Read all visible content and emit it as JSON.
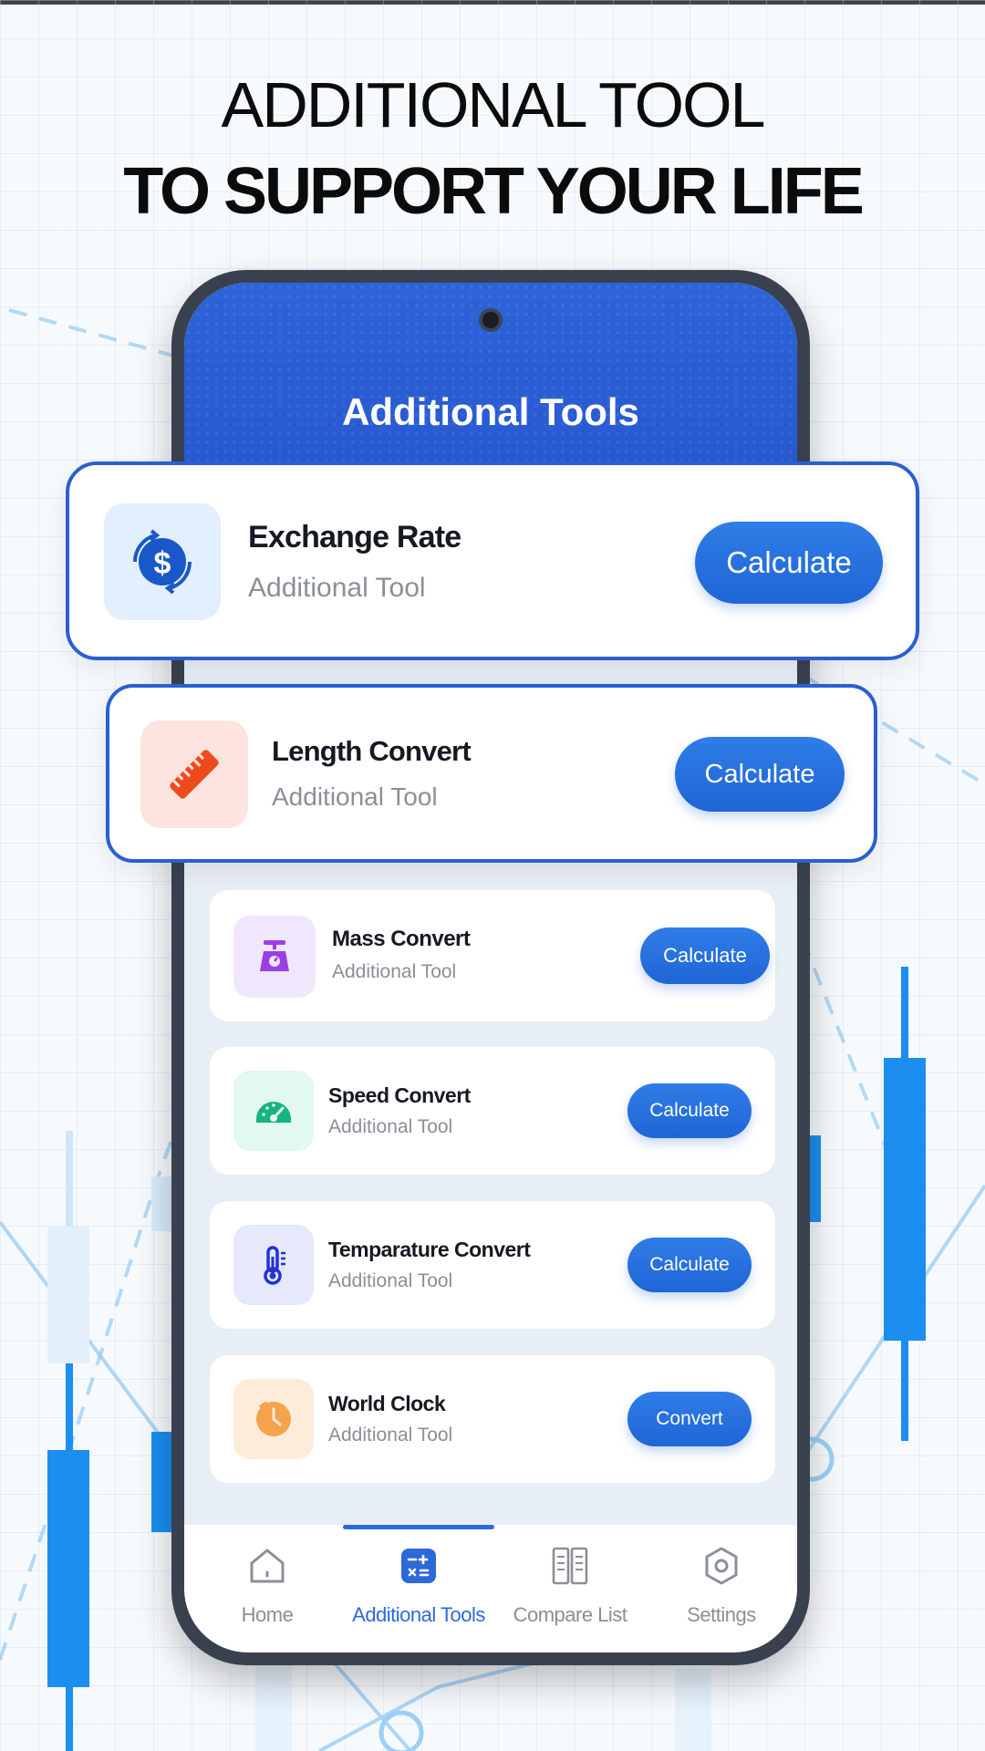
{
  "headline": {
    "line1": "ADDITIONAL TOOL",
    "line2": "TO SUPPORT YOUR LIFE"
  },
  "app": {
    "title": "Additional Tools"
  },
  "featured": [
    {
      "title": "Exchange Rate",
      "subtitle": "Additional Tool",
      "button": "Calculate",
      "icon": "exchange-rate-icon"
    },
    {
      "title": "Length Convert",
      "subtitle": "Additional Tool",
      "button": "Calculate",
      "icon": "ruler-icon"
    }
  ],
  "tools": [
    {
      "title": "Mass Convert",
      "subtitle": "Additional Tool",
      "button": "Calculate",
      "icon": "scale-icon"
    },
    {
      "title": "Speed Convert",
      "subtitle": "Additional Tool",
      "button": "Calculate",
      "icon": "speedometer-icon"
    },
    {
      "title": "Temparature Convert",
      "subtitle": "Additional Tool",
      "button": "Calculate",
      "icon": "thermometer-icon"
    },
    {
      "title": "World Clock",
      "subtitle": "Additional Tool",
      "button": "Convert",
      "icon": "clock-icon"
    }
  ],
  "nav": [
    {
      "label": "Home",
      "icon": "home-icon",
      "active": false
    },
    {
      "label": "Additional Tools",
      "icon": "calculator-icon",
      "active": true
    },
    {
      "label": "Compare List",
      "icon": "compare-list-icon",
      "active": false
    },
    {
      "label": "Settings",
      "icon": "settings-icon",
      "active": false
    }
  ],
  "colors": {
    "primary": "#2a5fd3",
    "button": "#1f65d6",
    "header": "#2e63d8"
  }
}
